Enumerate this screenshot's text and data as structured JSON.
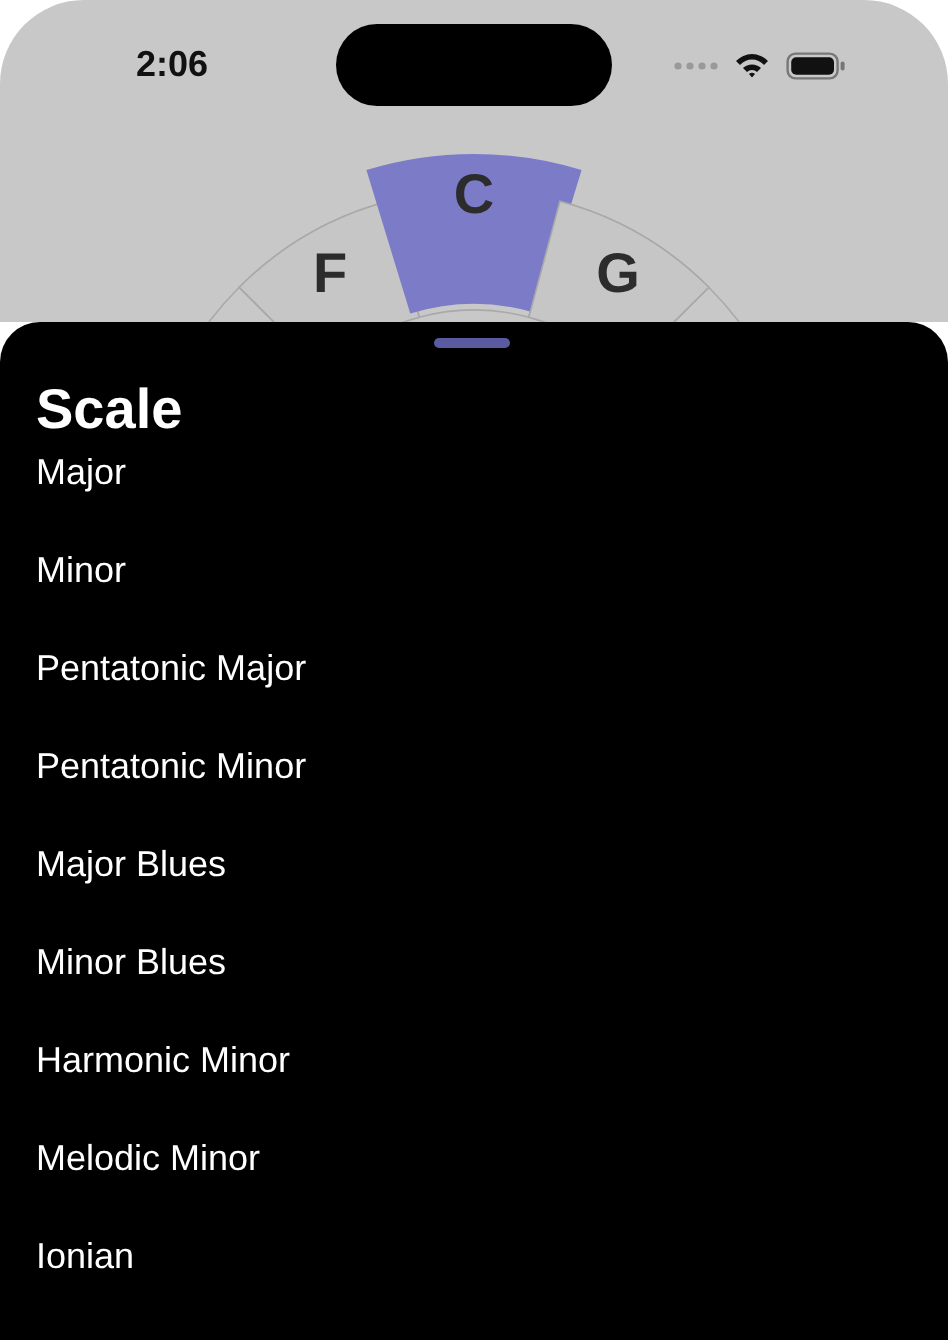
{
  "status_bar": {
    "time": "2:06"
  },
  "keys": [
    {
      "label": "F",
      "selected": false
    },
    {
      "label": "C",
      "selected": true
    },
    {
      "label": "G",
      "selected": false
    }
  ],
  "sheet": {
    "title": "Scale",
    "items": [
      "Major",
      "Minor",
      "Pentatonic Major",
      "Pentatonic Minor",
      "Major Blues",
      "Minor Blues",
      "Harmonic Minor",
      "Melodic Minor",
      "Ionian"
    ]
  }
}
